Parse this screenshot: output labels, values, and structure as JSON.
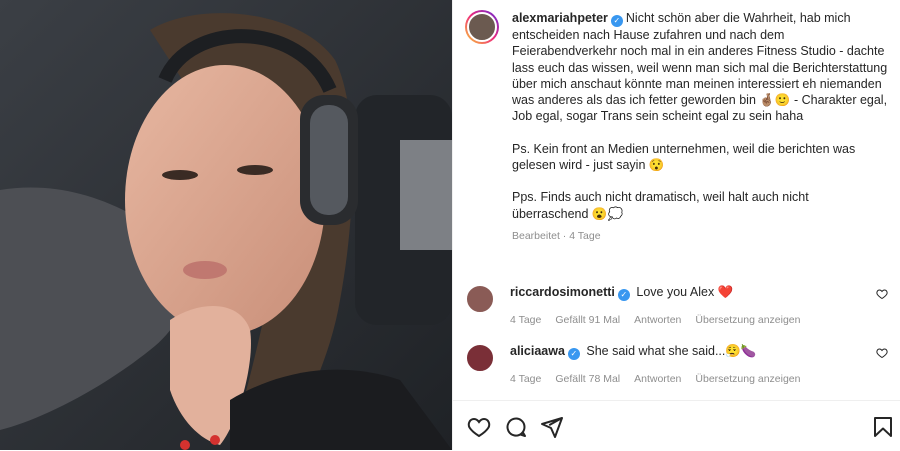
{
  "post": {
    "author": "alexmariahpeter",
    "caption_lines": [
      "Nicht schön aber die Wahrheit, hab mich entscheiden nach Hause zufahren und nach dem Feierabendverkehr noch mal in ein anderes Fitness Studio - dachte lass euch das wissen, weil wenn man sich mal die Berichterstattung über mich anschaut könnte man meinen interessiert eh niemanden was anderes als das ich fetter geworden bin 🤞🏽🙂 - Charakter egal, Job egal, sogar Trans sein scheint egal zu sein haha",
      "Ps. Kein front an Medien unternehmen, weil die berichten was gelesen wird - just sayin 😯",
      "Pps. Finds auch nicht dramatisch, weil halt auch nicht überraschend 😮💭"
    ],
    "edited_label": "Bearbeitet",
    "time_ago": "4 Tage"
  },
  "comments": [
    {
      "username": "riccardosimonetti",
      "text": "Love you Alex ❤️",
      "time": "4 Tage",
      "likes": "Gefällt 91 Mal",
      "reply_label": "Antworten",
      "translate_label": "Übersetzung anzeigen"
    },
    {
      "username": "aliciaawa",
      "text": "She said what she said...😮‍💨🍆",
      "time": "4 Tage",
      "likes": "Gefällt 78 Mal",
      "reply_label": "Antworten",
      "translate_label": "Übersetzung anzeigen"
    }
  ],
  "icons": {
    "verified": "verified-badge-icon",
    "like": "heart-icon",
    "comment": "comment-icon",
    "share": "send-icon",
    "save": "bookmark-icon"
  },
  "colors": {
    "verified": "#3897f0",
    "muted_text": "#8e8e8e",
    "text": "#262626"
  }
}
